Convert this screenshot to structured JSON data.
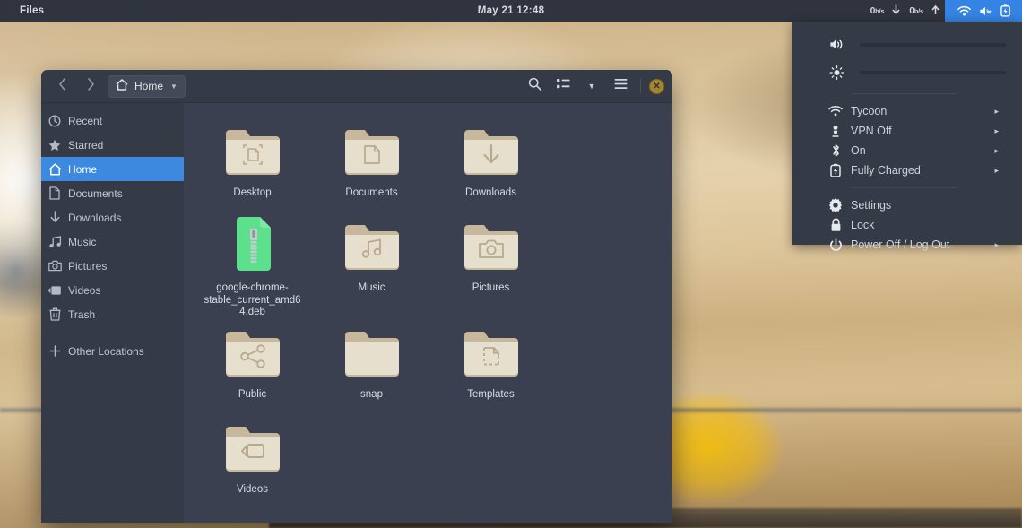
{
  "topbar": {
    "app_name": "Files",
    "clock": "May 21  12:48",
    "net_down_rate": "0",
    "net_down_unit": "b/s",
    "net_up_rate": "0",
    "net_up_unit": "b/s",
    "down_arrow_icon": "arrow-down-icon",
    "up_arrow_icon": "arrow-up-icon",
    "status_icons": [
      "wifi-icon",
      "volume-muted-icon",
      "battery-charging-icon"
    ],
    "accent_color": "#3584e4",
    "background_color": "#30343f"
  },
  "system_menu": {
    "volume_icon": "volume-icon",
    "brightness_icon": "brightness-icon",
    "items": [
      {
        "icon": "wifi-icon",
        "label": "Tycoon",
        "has_submenu": true
      },
      {
        "icon": "vpn-icon",
        "label": "VPN Off",
        "has_submenu": true
      },
      {
        "icon": "bluetooth-icon",
        "label": "On",
        "has_submenu": true
      },
      {
        "icon": "battery-icon",
        "label": "Fully Charged",
        "has_submenu": true
      }
    ],
    "actions": [
      {
        "icon": "gear-icon",
        "label": "Settings",
        "has_submenu": false
      },
      {
        "icon": "lock-icon",
        "label": "Lock",
        "has_submenu": false
      },
      {
        "icon": "power-icon",
        "label": "Power Off / Log Out",
        "has_submenu": true
      }
    ],
    "submenu_arrow": "▸",
    "background_color": "#353a47"
  },
  "files_window": {
    "headerbar": {
      "back_icon": "chevron-left-icon",
      "forward_icon": "chevron-right-icon",
      "path_icon": "home-icon",
      "path_label": "Home",
      "path_caret_icon": "chevron-down-icon",
      "search_icon": "search-icon",
      "view_toggle_icon": "list-view-icon",
      "view_caret_icon": "chevron-down-icon",
      "menu_icon": "hamburger-menu-icon",
      "close_icon": "close-icon",
      "close_glyph": "✕",
      "close_color": "#a3862f"
    },
    "sidebar": {
      "items": [
        {
          "icon": "clock-icon",
          "label": "Recent",
          "selected": false
        },
        {
          "icon": "star-icon",
          "label": "Starred",
          "selected": false
        },
        {
          "icon": "home-icon",
          "label": "Home",
          "selected": true
        },
        {
          "icon": "document-icon",
          "label": "Documents",
          "selected": false
        },
        {
          "icon": "download-icon",
          "label": "Downloads",
          "selected": false
        },
        {
          "icon": "music-icon",
          "label": "Music",
          "selected": false
        },
        {
          "icon": "camera-icon",
          "label": "Pictures",
          "selected": false
        },
        {
          "icon": "video-icon",
          "label": "Videos",
          "selected": false
        },
        {
          "icon": "trash-icon",
          "label": "Trash",
          "selected": false
        }
      ],
      "other_locations": {
        "icon": "plus-icon",
        "label": "Other Locations"
      },
      "selected_color": "#3d89e0"
    },
    "files": [
      {
        "name": "Desktop",
        "type": "folder",
        "emblem": "desktop-emblem"
      },
      {
        "name": "Documents",
        "type": "folder",
        "emblem": "document-emblem"
      },
      {
        "name": "Downloads",
        "type": "folder",
        "emblem": "download-emblem"
      },
      {
        "name": "google-chrome-stable_current_amd64.deb",
        "type": "archive",
        "emblem": "zipper-emblem"
      },
      {
        "name": "Music",
        "type": "folder",
        "emblem": "music-emblem"
      },
      {
        "name": "Pictures",
        "type": "folder",
        "emblem": "camera-emblem"
      },
      {
        "name": "Public",
        "type": "folder",
        "emblem": "share-emblem"
      },
      {
        "name": "snap",
        "type": "folder",
        "emblem": "none"
      },
      {
        "name": "Templates",
        "type": "folder",
        "emblem": "template-emblem"
      },
      {
        "name": "Videos",
        "type": "folder",
        "emblem": "camcorder-emblem"
      }
    ],
    "folder_color": "#e7dfcd",
    "folder_tab_color": "#c7b79b",
    "archive_color": "#5ce08b"
  }
}
